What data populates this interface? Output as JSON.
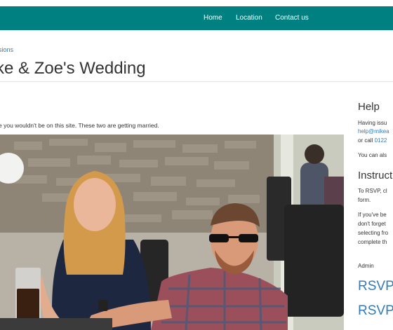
{
  "nav": {
    "home": "Home",
    "location": "Location",
    "contact": "Contact us"
  },
  "breadcrumb": "sions",
  "page_title": "ke & Zoe's Wedding",
  "intro": "e you wouldn't be on this site. These two are getting married.",
  "sidebar": {
    "help_heading": "Help",
    "help_line1": "Having issu",
    "help_email": "help@mikea",
    "help_call_prefix": "or call ",
    "help_phone": "0122",
    "help_line4": "You can als",
    "instructions_heading": "Instruct",
    "instr_line1": "To RSVP, cl",
    "instr_line2": "form.",
    "instr_line3": "If you've be",
    "instr_line4": "don't forget",
    "instr_line5": "selecting fro",
    "instr_line6": "complete th",
    "admin": "Admin",
    "rsvp1": "RSVP",
    "rsvp2": "RSVP"
  },
  "colors": {
    "navbar": "#008080",
    "link": "#337ab7",
    "text": "#333333"
  }
}
